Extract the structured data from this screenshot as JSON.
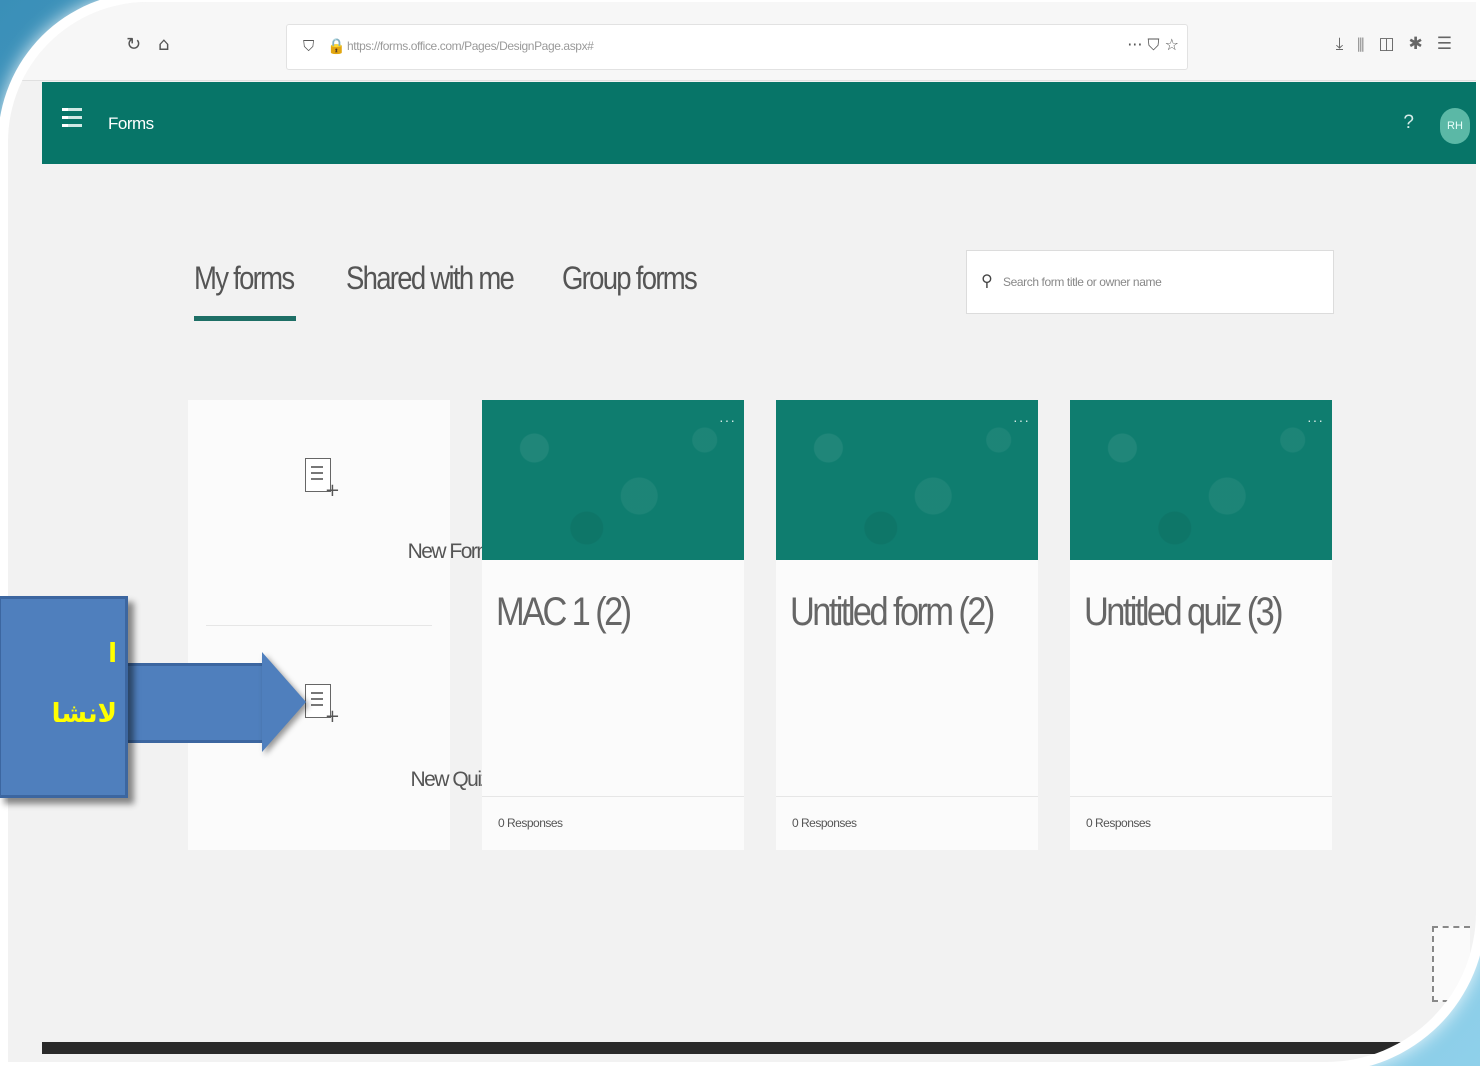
{
  "browser": {
    "url": "https://forms.office.com/Pages/DesignPage.aspx#",
    "more_icon": "ellipsis-icon",
    "toolbar_icons": [
      "download-icon",
      "library-icon",
      "sidebar-icon",
      "extension-icon",
      "menu-icon"
    ]
  },
  "appbar": {
    "app_name": "Forms",
    "help": "?",
    "avatar": "RH"
  },
  "tabs": [
    {
      "label": "My forms",
      "active": true
    },
    {
      "label": "Shared with me",
      "active": false
    },
    {
      "label": "Group forms",
      "active": false
    }
  ],
  "search": {
    "placeholder": "Search form title or owner name"
  },
  "new_items": [
    {
      "label": "New Form"
    },
    {
      "label": "New Quiz"
    }
  ],
  "forms": [
    {
      "title": "MAC 1 (2)",
      "responses": "0 Responses"
    },
    {
      "title": "Untitled form (2)",
      "responses": "0 Responses"
    },
    {
      "title": "Untitled quiz (3)",
      "responses": "0 Responses"
    }
  ],
  "callout": {
    "line1": "ا",
    "line2": "لانشا"
  },
  "colors": {
    "accent": "#077568",
    "callout": "#4f7fbd",
    "callout_text": "#ffff00"
  }
}
